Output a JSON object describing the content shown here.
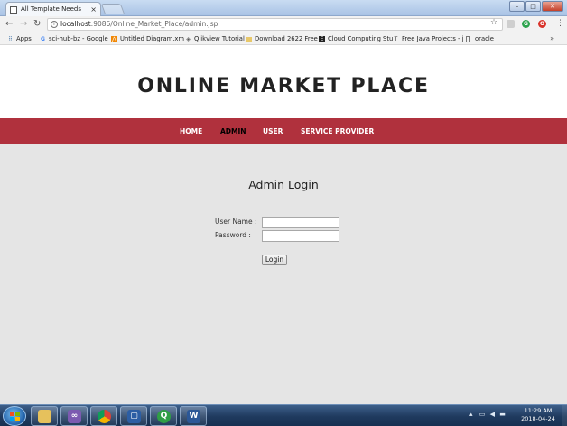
{
  "browser": {
    "tab_title": "All Template Needs",
    "tab_close": "×",
    "url_host": "localhost",
    "url_rest": ":9086/Online_Market_Place/admin.jsp",
    "bookmarks": [
      {
        "label": "Apps",
        "icon": "apps-icon"
      },
      {
        "label": "sci-hub-bz - Google",
        "icon": "google-icon"
      },
      {
        "label": "Untitled Diagram.xm",
        "icon": "drawio-icon"
      },
      {
        "label": "Qlikview Tutorial",
        "icon": "qlik-icon"
      },
      {
        "label": "Download 2622 Free",
        "icon": "folder-icon"
      },
      {
        "label": "Cloud Computing Stu",
        "icon": "cloud-icon"
      },
      {
        "label": "Free Java Projects - j",
        "icon": "text-icon"
      },
      {
        "label": "oracle",
        "icon": "page-icon"
      }
    ],
    "bookmarks_more": "»"
  },
  "site": {
    "title": "ONLINE MARKET PLACE",
    "nav": [
      {
        "label": "HOME",
        "active": false
      },
      {
        "label": "ADMIN",
        "active": true
      },
      {
        "label": "USER",
        "active": false
      },
      {
        "label": "SERVICE PROVIDER",
        "active": false
      }
    ]
  },
  "login": {
    "heading": "Admin Login",
    "username_label": "User Name :",
    "password_label": "Password :",
    "username_value": "",
    "password_value": "",
    "button_label": "Login"
  },
  "taskbar": {
    "apps": [
      "explorer-icon",
      "visual-studio-icon",
      "chrome-icon",
      "virtualbox-icon",
      "qlikview-icon",
      "word-icon"
    ],
    "time": "11:29 AM",
    "date": "2018-04-24"
  },
  "colors": {
    "nav_bar": "#b0313d",
    "page_bg": "#e5e5e5"
  }
}
